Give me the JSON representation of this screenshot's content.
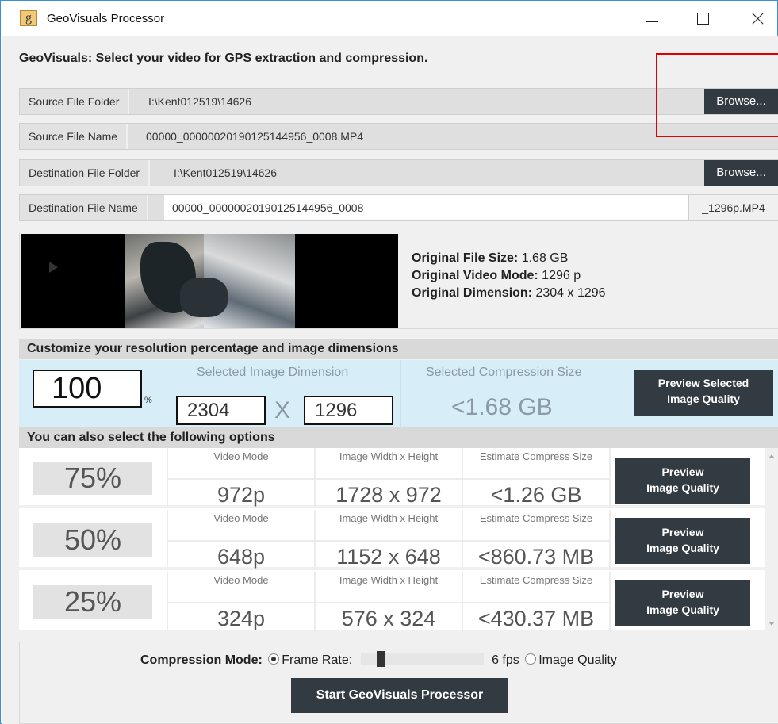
{
  "window": {
    "icon_glyph": "g",
    "title": "GeoVisuals Processor"
  },
  "heading": "GeoVisuals: Select your video for GPS extraction and compression.",
  "source": {
    "folder_label": "Source File Folder",
    "folder_value": "I:\\Kent012519\\14626",
    "browse_label": "Browse...",
    "name_label": "Source File Name",
    "name_value": "00000_00000020190125144956_0008.MP4"
  },
  "destination": {
    "folder_label": "Destination File Folder",
    "folder_value": "I:\\Kent012519\\14626",
    "browse_label": "Browse...",
    "name_label": "Destination File Name",
    "name_value": "00000_00000020190125144956_0008",
    "suffix": "_1296p.MP4"
  },
  "original": {
    "size_label": "Original File Size:",
    "size_value": "1.68 GB",
    "mode_label": "Original Video Mode:",
    "mode_value": "1296 p",
    "dim_label": "Original Dimension:",
    "dim_value": "2304 x 1296"
  },
  "customize": {
    "title": "Customize your resolution percentage and image dimensions",
    "percent": "100",
    "percent_sign": "%",
    "dim_header": "Selected Image Dimension",
    "width": "2304",
    "x_sep": "X",
    "height": "1296",
    "comp_header": "Selected Compression Size",
    "comp_value": "<1.68 GB",
    "preview_line1": "Preview Selected",
    "preview_line2": "Image Quality"
  },
  "options": {
    "title": "You can also select the following options",
    "col_mode": "Video Mode",
    "col_dim": "Image Width x Height",
    "col_size": "Estimate Compress Size",
    "preview_line1": "Preview",
    "preview_line2": "Image Quality",
    "items": [
      {
        "pct": "75%",
        "mode": "972p",
        "dim": "1728 x 972",
        "size": "<1.26 GB"
      },
      {
        "pct": "50%",
        "mode": "648p",
        "dim": "1152 x 648",
        "size": "<860.73 MB"
      },
      {
        "pct": "25%",
        "mode": "324p",
        "dim": "576 x 324",
        "size": "<430.37 MB"
      }
    ]
  },
  "compression": {
    "label": "Compression Mode:",
    "frame_rate": "Frame Rate:",
    "fps": "6 fps",
    "image_quality": "Image Quality",
    "selected": "frame_rate"
  },
  "start_button": "Start GeoVisuals Processor"
}
